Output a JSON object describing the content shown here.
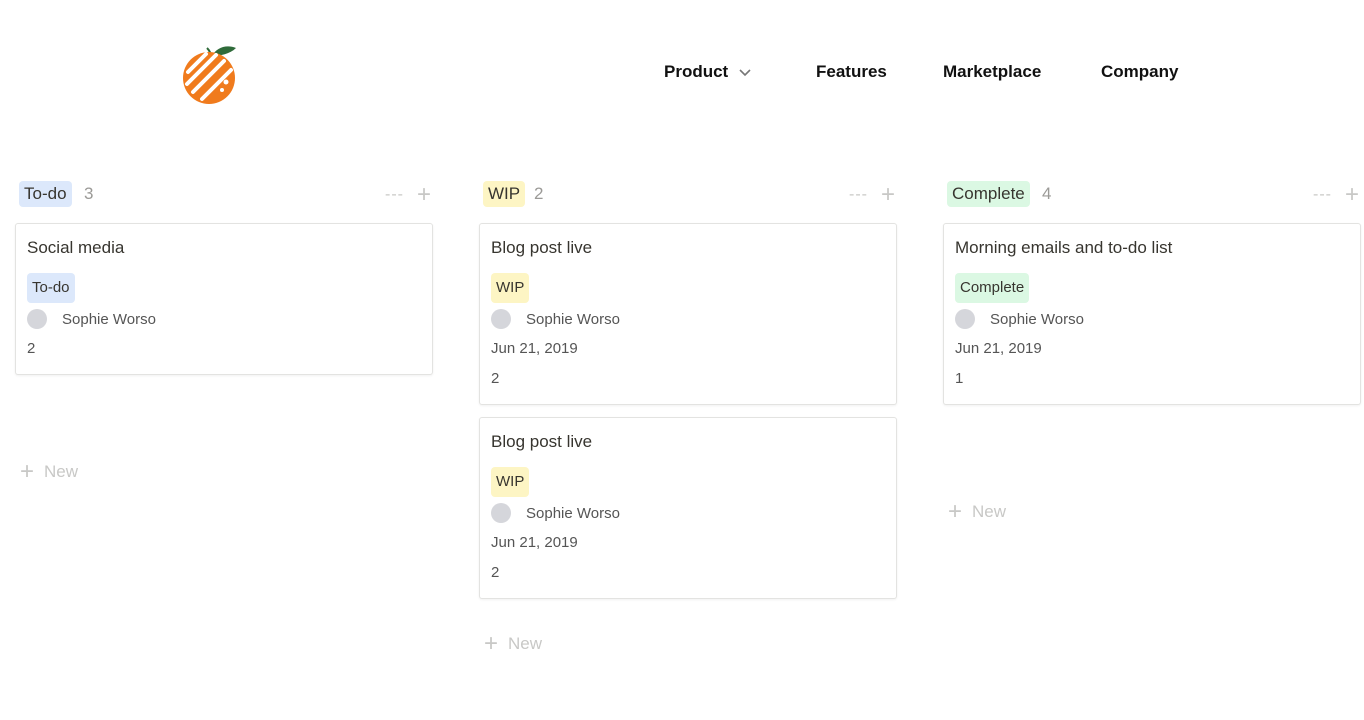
{
  "nav": {
    "logo_icon": "orange-fruit-logo",
    "items": [
      {
        "label": "Product",
        "has_dropdown": true
      },
      {
        "label": "Features"
      },
      {
        "label": "Marketplace"
      },
      {
        "label": "Company"
      }
    ]
  },
  "colors": {
    "todo_tag": "#dce8fb",
    "wip_tag": "#fdf5c4",
    "complete_tag": "#dbf8e3",
    "logo_orange": "#f07b1d",
    "logo_leaf": "#2f6b3a"
  },
  "columns": [
    {
      "title": "To-do",
      "count": "3",
      "actions": {
        "more": "---",
        "add": "+"
      },
      "cards": [
        {
          "title": "Social media",
          "tag": "To-do",
          "person": "Sophie Worso",
          "number": "2"
        }
      ],
      "new_label": "New"
    },
    {
      "title": "WIP",
      "count": "2",
      "actions": {
        "more": "---",
        "add": "+"
      },
      "cards": [
        {
          "title": "Blog post live",
          "tag": "WIP",
          "person": "Sophie Worso",
          "date": "Jun 21, 2019",
          "number": "2"
        },
        {
          "title": "Blog post live",
          "tag": "WIP",
          "person": "Sophie Worso",
          "date": "Jun 21, 2019",
          "number": "2"
        }
      ],
      "new_label": "New"
    },
    {
      "title": "Complete",
      "count": "4",
      "actions": {
        "more": "---",
        "add": "+"
      },
      "cards": [
        {
          "title": "Morning emails and to-do list",
          "tag": "Complete",
          "person": "Sophie Worso",
          "date": "Jun 21, 2019",
          "number": "1"
        }
      ],
      "new_label": "New"
    }
  ]
}
